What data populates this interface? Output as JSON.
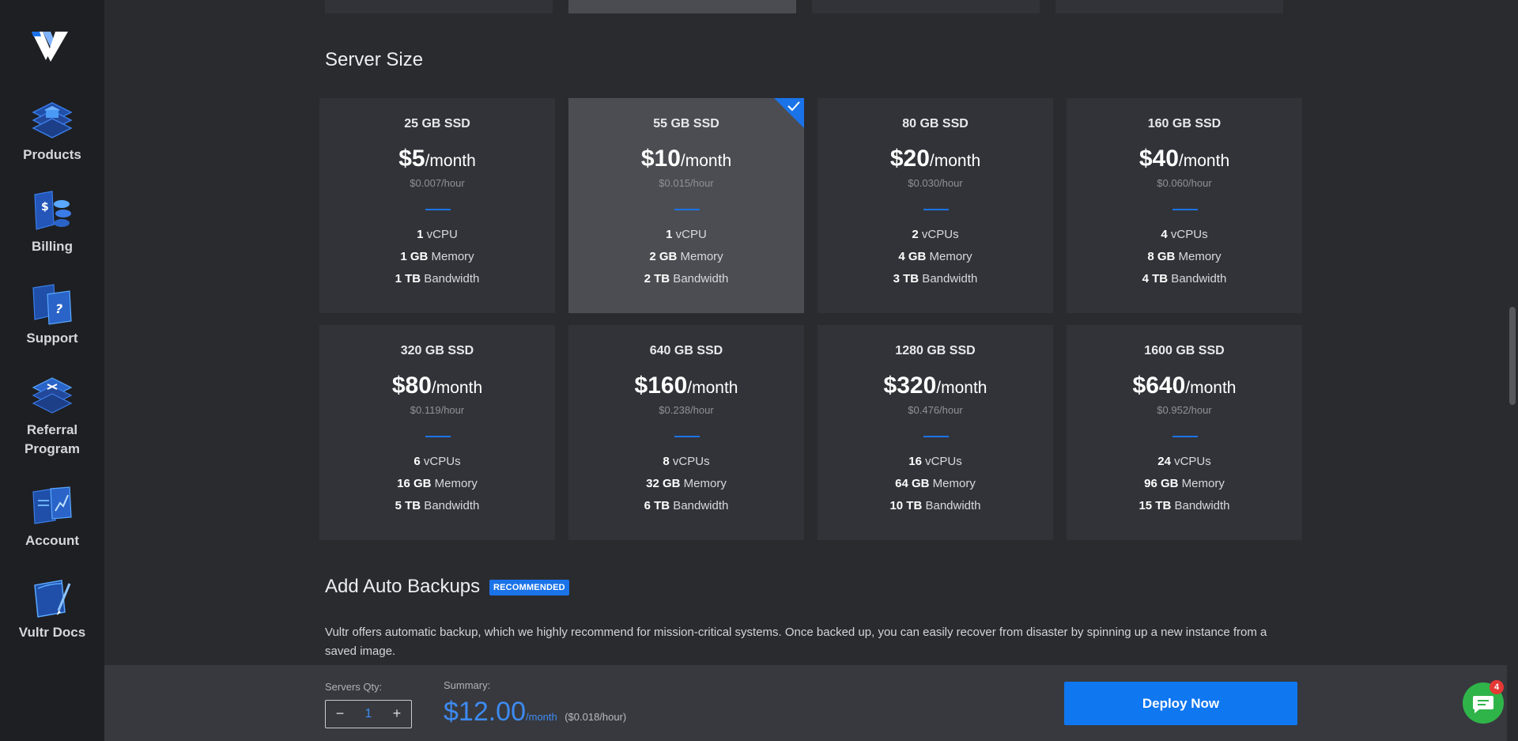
{
  "sidebar": {
    "items": [
      {
        "label": "Products"
      },
      {
        "label": "Billing"
      },
      {
        "label": "Support"
      },
      {
        "label": "Referral Program"
      },
      {
        "label": "Account"
      },
      {
        "label": "Vultr Docs"
      }
    ]
  },
  "server_size": {
    "title": "Server Size",
    "plans": [
      {
        "storage": "25 GB SSD",
        "price": "$5",
        "per": "/month",
        "hourly": "$0.007/hour",
        "cpu_n": "1",
        "cpu_l": " vCPU",
        "mem_n": "1 GB",
        "mem_l": " Memory",
        "bw_n": "1 TB",
        "bw_l": " Bandwidth"
      },
      {
        "storage": "55 GB SSD",
        "price": "$10",
        "per": "/month",
        "hourly": "$0.015/hour",
        "cpu_n": "1",
        "cpu_l": " vCPU",
        "mem_n": "2 GB",
        "mem_l": " Memory",
        "bw_n": "2 TB",
        "bw_l": " Bandwidth",
        "selected": true
      },
      {
        "storage": "80 GB SSD",
        "price": "$20",
        "per": "/month",
        "hourly": "$0.030/hour",
        "cpu_n": "2",
        "cpu_l": " vCPUs",
        "mem_n": "4 GB",
        "mem_l": " Memory",
        "bw_n": "3 TB",
        "bw_l": " Bandwidth"
      },
      {
        "storage": "160 GB SSD",
        "price": "$40",
        "per": "/month",
        "hourly": "$0.060/hour",
        "cpu_n": "4",
        "cpu_l": " vCPUs",
        "mem_n": "8 GB",
        "mem_l": " Memory",
        "bw_n": "4 TB",
        "bw_l": " Bandwidth"
      },
      {
        "storage": "320 GB SSD",
        "price": "$80",
        "per": "/month",
        "hourly": "$0.119/hour",
        "cpu_n": "6",
        "cpu_l": " vCPUs",
        "mem_n": "16 GB",
        "mem_l": " Memory",
        "bw_n": "5 TB",
        "bw_l": " Bandwidth"
      },
      {
        "storage": "640 GB SSD",
        "price": "$160",
        "per": "/month",
        "hourly": "$0.238/hour",
        "cpu_n": "8",
        "cpu_l": " vCPUs",
        "mem_n": "32 GB",
        "mem_l": " Memory",
        "bw_n": "6 TB",
        "bw_l": " Bandwidth"
      },
      {
        "storage": "1280 GB SSD",
        "price": "$320",
        "per": "/month",
        "hourly": "$0.476/hour",
        "cpu_n": "16",
        "cpu_l": " vCPUs",
        "mem_n": "64 GB",
        "mem_l": " Memory",
        "bw_n": "10 TB",
        "bw_l": " Bandwidth"
      },
      {
        "storage": "1600 GB SSD",
        "price": "$640",
        "per": "/month",
        "hourly": "$0.952/hour",
        "cpu_n": "24",
        "cpu_l": " vCPUs",
        "mem_n": "96 GB",
        "mem_l": " Memory",
        "bw_n": "15 TB",
        "bw_l": " Bandwidth"
      }
    ]
  },
  "backups": {
    "title": "Add Auto Backups",
    "badge": "RECOMMENDED",
    "description": "Vultr offers automatic backup, which we highly recommend for mission-critical systems. Once backed up, you can easily recover from disaster by spinning up a new instance from a saved image."
  },
  "bottom_bar": {
    "qty_label": "Servers Qty:",
    "qty_value": "1",
    "minus": "−",
    "plus": "+",
    "summary_label": "Summary:",
    "amount": "$12.00",
    "per": "/month",
    "hourly": "($0.018/hour)",
    "deploy_label": "Deploy Now"
  },
  "chat": {
    "badge": "4"
  },
  "colors": {
    "accent": "#1a73e8",
    "chat": "#2fb44a"
  }
}
